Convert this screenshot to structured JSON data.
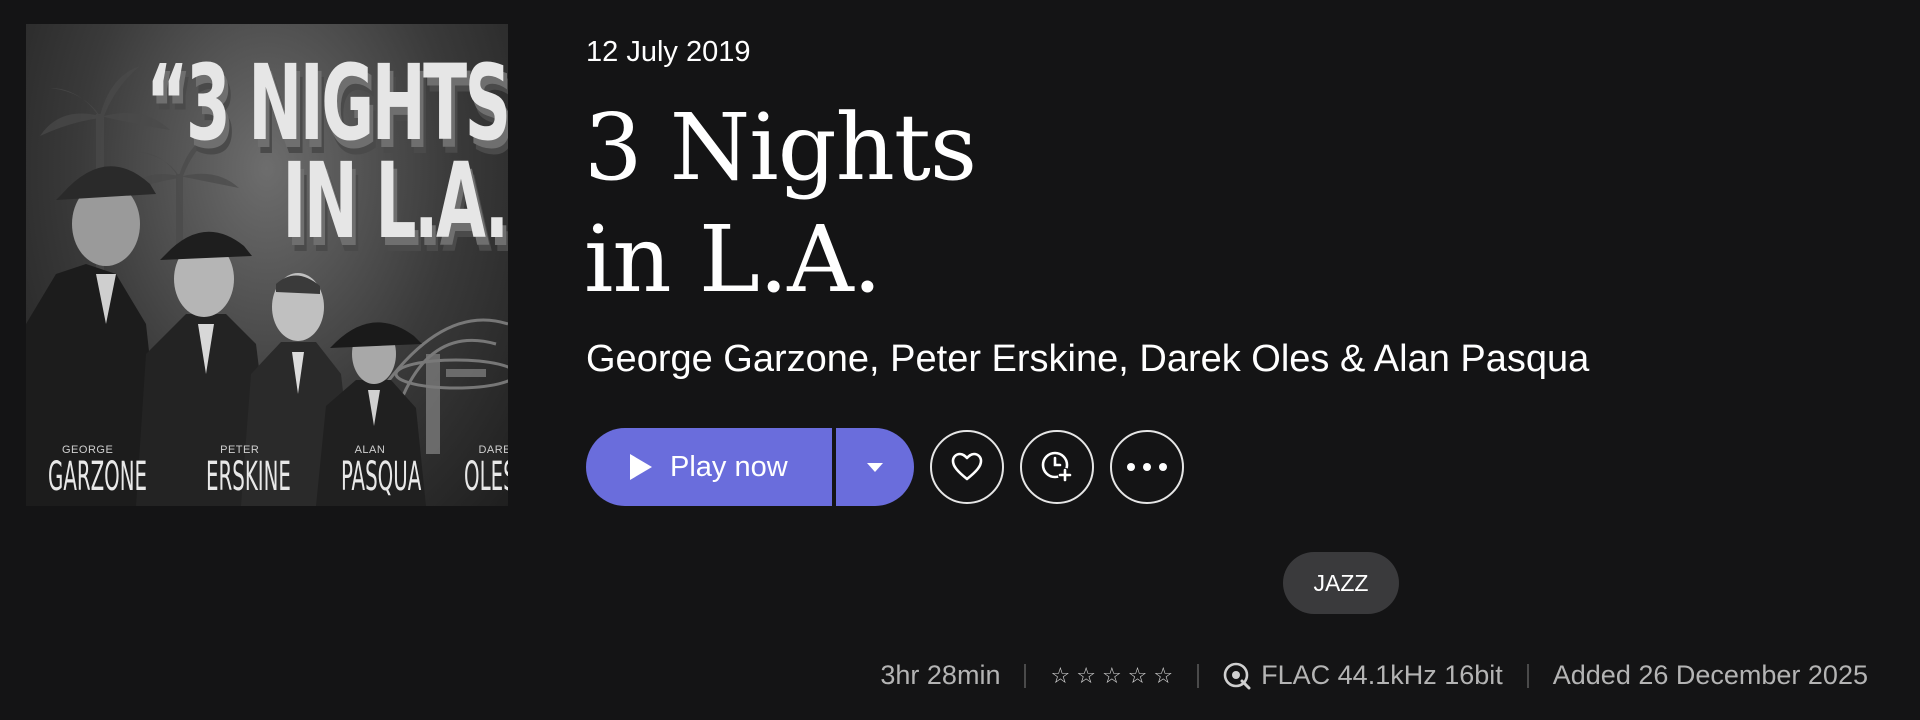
{
  "album": {
    "release_date": "12 July 2019",
    "title_line1": "3 Nights",
    "title_line2": "in L.A.",
    "artists": "George Garzone, Peter Erskine, Darek Oles & Alan Pasqua",
    "genre": "JAZZ",
    "duration": "3hr 28min",
    "rating_stars": 0,
    "rating_max": 5,
    "quality": "FLAC 44.1kHz 16bit",
    "added": "Added 26 December 2025"
  },
  "cover": {
    "title_line1": "“3 NIGHTS",
    "title_line2": "IN L.A.”",
    "names": [
      {
        "first": "GEORGE",
        "last": "GARZONE"
      },
      {
        "first": "PETER",
        "last": "ERSKINE"
      },
      {
        "first": "ALAN",
        "last": "PASQUA"
      },
      {
        "first": "DAREK",
        "last": "OLES"
      }
    ]
  },
  "actions": {
    "play_label": "Play now",
    "play_options_icon": "chevron-down-icon",
    "favorite_icon": "heart-icon",
    "queue_icon": "clock-add-icon",
    "more_icon": "more-horizontal-icon"
  },
  "colors": {
    "background": "#141415",
    "accent": "#6a6ddc",
    "chip": "#3a3a3c",
    "muted_text": "#b4b4b4"
  }
}
